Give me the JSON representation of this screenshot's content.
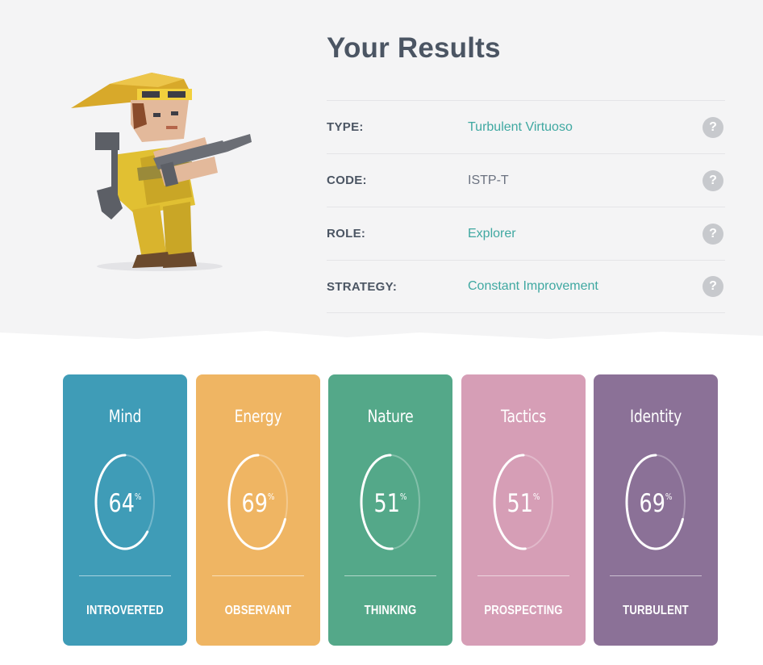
{
  "results": {
    "title": "Your Results",
    "rows": [
      {
        "label": "TYPE:",
        "value": "Turbulent Virtuoso",
        "help": "?"
      },
      {
        "label": "CODE:",
        "value": "ISTP-T",
        "help": "?"
      },
      {
        "label": "ROLE:",
        "value": "Explorer",
        "help": "?"
      },
      {
        "label": "STRATEGY:",
        "value": "Constant Improvement",
        "help": "?"
      }
    ]
  },
  "avatar_icon": "explorer-character-illustration",
  "cards": [
    {
      "name": "Mind",
      "percent": "64",
      "unit": "%",
      "trait": "INTROVERTED",
      "color": "#3f9cb7",
      "fraction": 0.64
    },
    {
      "name": "Energy",
      "percent": "69",
      "unit": "%",
      "trait": "OBSERVANT",
      "color": "#efb563",
      "fraction": 0.69
    },
    {
      "name": "Nature",
      "percent": "51",
      "unit": "%",
      "trait": "THINKING",
      "color": "#54a889",
      "fraction": 0.51
    },
    {
      "name": "Tactics",
      "percent": "51",
      "unit": "%",
      "trait": "PROSPECTING",
      "color": "#d69eb6",
      "fraction": 0.51
    },
    {
      "name": "Identity",
      "percent": "69",
      "unit": "%",
      "trait": "TURBULENT",
      "color": "#8b7197",
      "fraction": 0.69
    }
  ],
  "accent_color": "#3fa8a1"
}
